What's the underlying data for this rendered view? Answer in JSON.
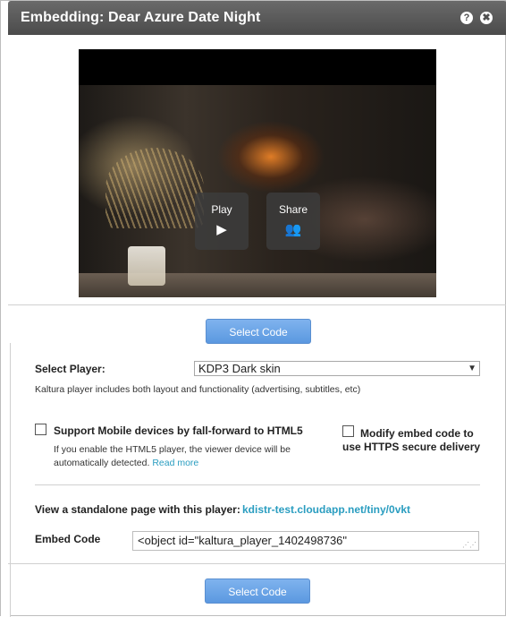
{
  "dialog": {
    "title": "Embedding: Dear Azure Date Night",
    "help_icon": "?",
    "close_icon": "✖"
  },
  "video": {
    "play_label": "Play",
    "share_label": "Share",
    "play_icon": "▶",
    "share_icon": "👥"
  },
  "buttons": {
    "select_code_top": "Select Code",
    "select_code_bottom": "Select Code"
  },
  "player": {
    "label": "Select Player:",
    "selected": "KDP3 Dark skin",
    "description": "Kaltura player includes both layout and functionality (advertising, subtitles, etc)"
  },
  "options": {
    "mobile_label": "Support Mobile devices by fall-forward to HTML5",
    "mobile_help": "If you enable the HTML5 player, the viewer device will be automatically detected.",
    "mobile_help_line1": "If you enable the HTML5 player, the viewer device will be",
    "mobile_help_line2": "automatically detected.",
    "read_more": "Read more",
    "https_label_line1": "Modify embed code to",
    "https_label_line2": "use HTTPS secure delivery"
  },
  "standalone": {
    "label": "View a standalone page with this player:",
    "url": "kdistr-test.cloudapp.net/tiny/0vkt"
  },
  "embed": {
    "label": "Embed Code",
    "value": "<object id=\"kaltura_player_1402498736\""
  }
}
